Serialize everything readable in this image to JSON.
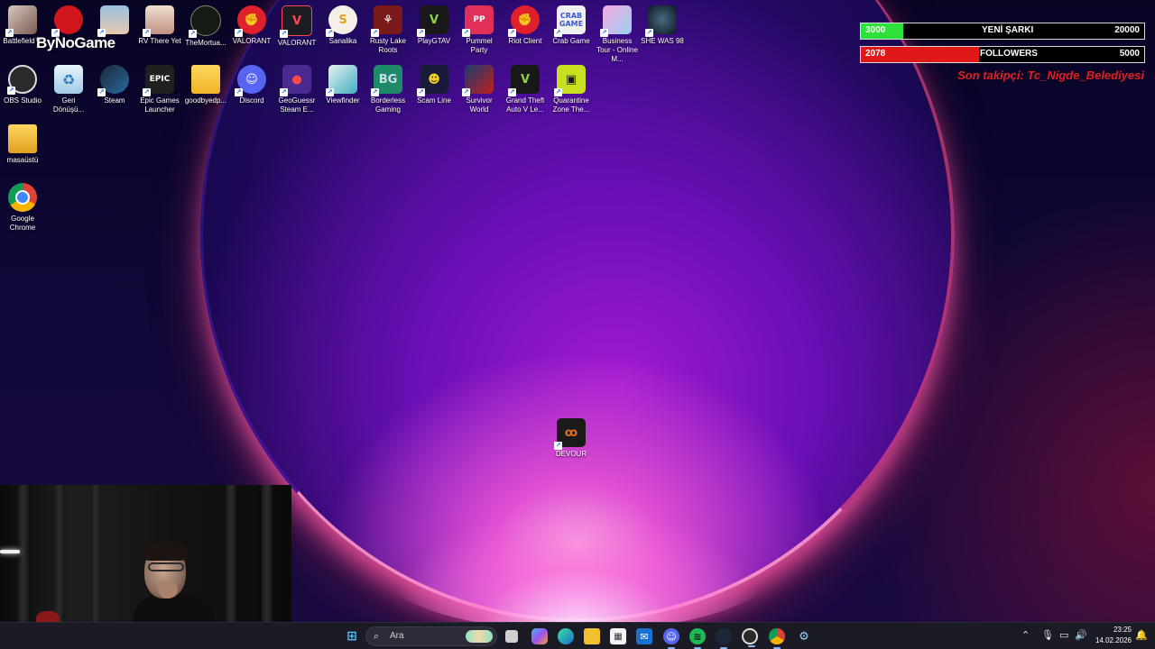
{
  "overlay": {
    "logo_text": "ByNoGame",
    "song_bar": {
      "left": "3000",
      "label": "YENİ ŞARKI",
      "right": "20000",
      "progress": 0.15
    },
    "follower_bar": {
      "left": "2078",
      "label": "FOLLOWERS",
      "right": "5000",
      "progress": 0.416
    },
    "latest_follower": "Son takipçi: Tc_Nigde_Belediyesi"
  },
  "desktop_icons": [
    {
      "label": "Battlefield™",
      "icon": "battlefield-icon"
    },
    {
      "label": "",
      "icon": "red-monster-icon"
    },
    {
      "label": "",
      "icon": "poster-game-icon"
    },
    {
      "label": "RV There Yet",
      "icon": "rv-there-yet-icon"
    },
    {
      "label": "TheMortua...",
      "icon": "the-mortuary-icon"
    },
    {
      "label": "VALORANT",
      "icon": "riot-fist-icon"
    },
    {
      "label": "VALORANT",
      "icon": "valorant-icon"
    },
    {
      "label": "Sanalika",
      "icon": "sanalika-icon"
    },
    {
      "label": "Rusty Lake Roots",
      "icon": "rusty-lake-icon"
    },
    {
      "label": "PlayGTAV",
      "icon": "gtav-icon"
    },
    {
      "label": "Pummel Party",
      "icon": "pummel-party-icon"
    },
    {
      "label": "Riot Client",
      "icon": "riot-client-icon"
    },
    {
      "label": "Crab Game",
      "icon": "crab-game-icon"
    },
    {
      "label": "Business Tour - Online M...",
      "icon": "business-tour-icon"
    },
    {
      "label": "SHE WAS 98",
      "icon": "she-was-98-icon"
    },
    {
      "label": "OBS Studio",
      "icon": "obs-icon"
    },
    {
      "label": "Geri Dönüşü...",
      "icon": "recycle-bin-icon"
    },
    {
      "label": "Steam",
      "icon": "steam-icon"
    },
    {
      "label": "Epic Games Launcher",
      "icon": "epic-games-icon"
    },
    {
      "label": "goodbyedp...",
      "icon": "folder-icon"
    },
    {
      "label": "Discord",
      "icon": "discord-icon"
    },
    {
      "label": "GeoGuessr Steam E...",
      "icon": "geoguessr-icon"
    },
    {
      "label": "Viewfinder",
      "icon": "viewfinder-icon"
    },
    {
      "label": "Borderless Gaming",
      "icon": "borderless-gaming-icon"
    },
    {
      "label": "Scam Line",
      "icon": "scam-line-icon"
    },
    {
      "label": "Survivor World",
      "icon": "survivor-world-icon"
    },
    {
      "label": "Grand Theft Auto V Le...",
      "icon": "gta-v-legacy-icon"
    },
    {
      "label": "Quarantine Zone The...",
      "icon": "quarantine-zone-icon"
    },
    {
      "label": "masaüstü",
      "icon": "folder-icon"
    },
    {
      "label": "Google Chrome",
      "icon": "chrome-icon"
    },
    {
      "label": "DEVOUR",
      "icon": "devour-icon"
    }
  ],
  "taskbar": {
    "search_placeholder": "Ara",
    "pinned": [
      "windows-start-icon",
      "search-icon",
      "task-view-icon",
      "copilot-icon",
      "edge-icon",
      "file-explorer-icon",
      "store-icon",
      "mail-icon",
      "discord-icon",
      "spotify-icon",
      "steam-icon",
      "obs-icon",
      "chrome-icon",
      "settings-gear-icon"
    ],
    "tray_icons": [
      "chevron-up-icon",
      "microphone-icon",
      "network-icon",
      "speaker-icon"
    ],
    "time": "23:25",
    "date": "14.02.2026"
  },
  "colors": {
    "song_bar_fill": "#2ee03a",
    "follower_bar_fill": "#e01818",
    "follower_text": "#e02020",
    "taskbar_bg": "#1b1b26"
  }
}
